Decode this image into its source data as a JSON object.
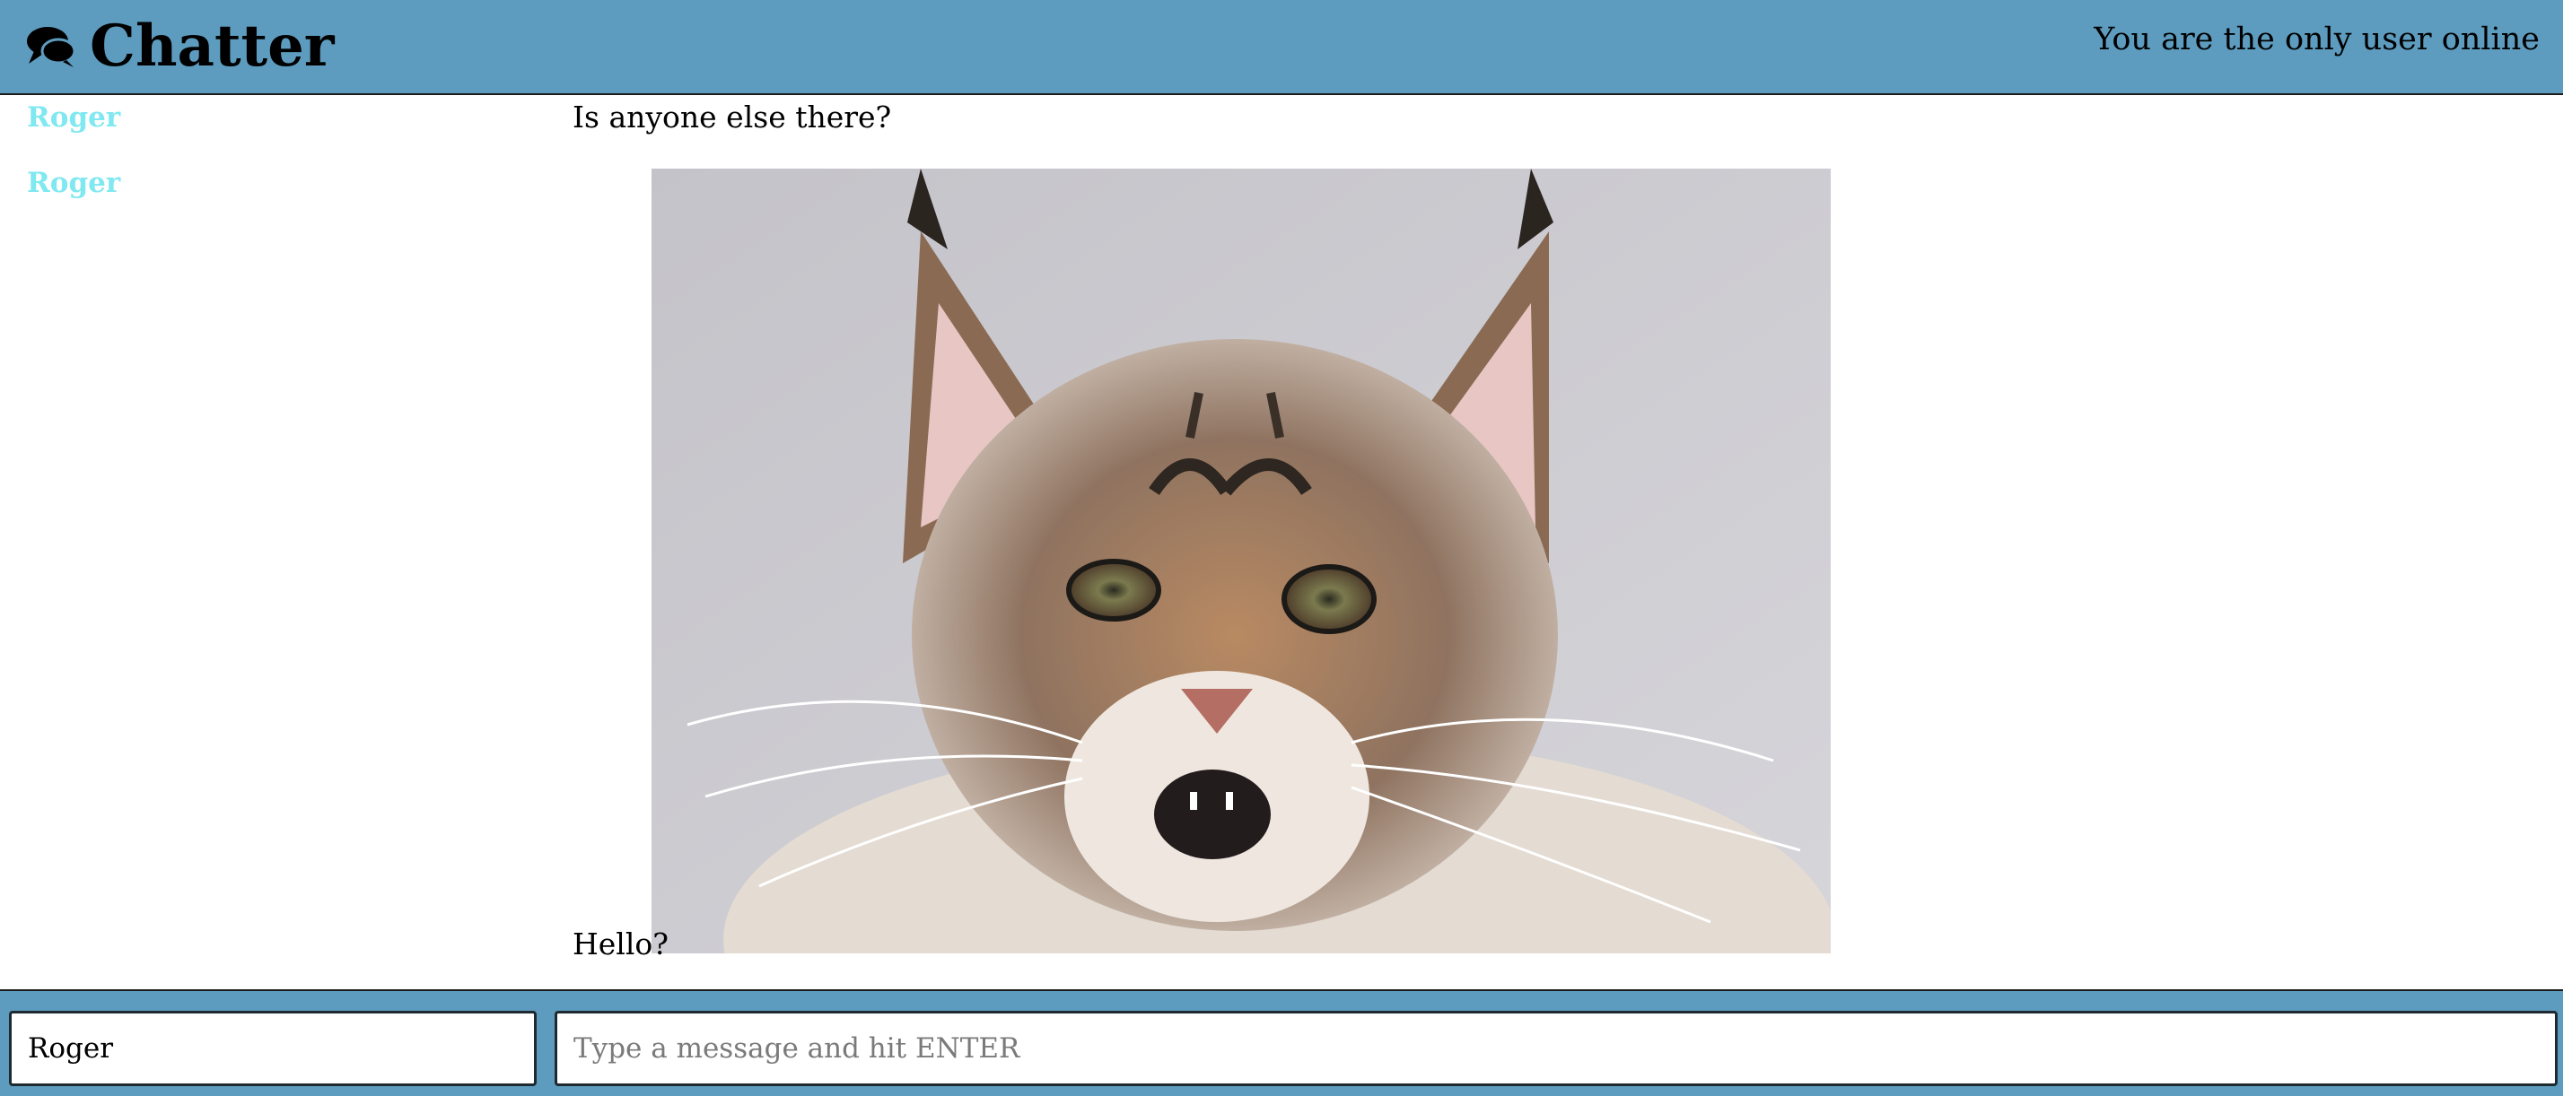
{
  "header": {
    "title": "Chatter",
    "online_status": "You are the only user online",
    "icon": "chat-bubbles-icon",
    "background_color": "#5d9cbf"
  },
  "users": [
    {
      "name": "Roger"
    },
    {
      "name": "Roger"
    }
  ],
  "messages": [
    {
      "text": "Is anyone else there?"
    },
    {
      "text": "Hello?",
      "image": "cat-photo"
    }
  ],
  "composer": {
    "name_value": "Roger",
    "message_placeholder": "Type a message and hit ENTER"
  },
  "colors": {
    "accent": "#5d9cbf",
    "username": "#7fe8f0"
  }
}
